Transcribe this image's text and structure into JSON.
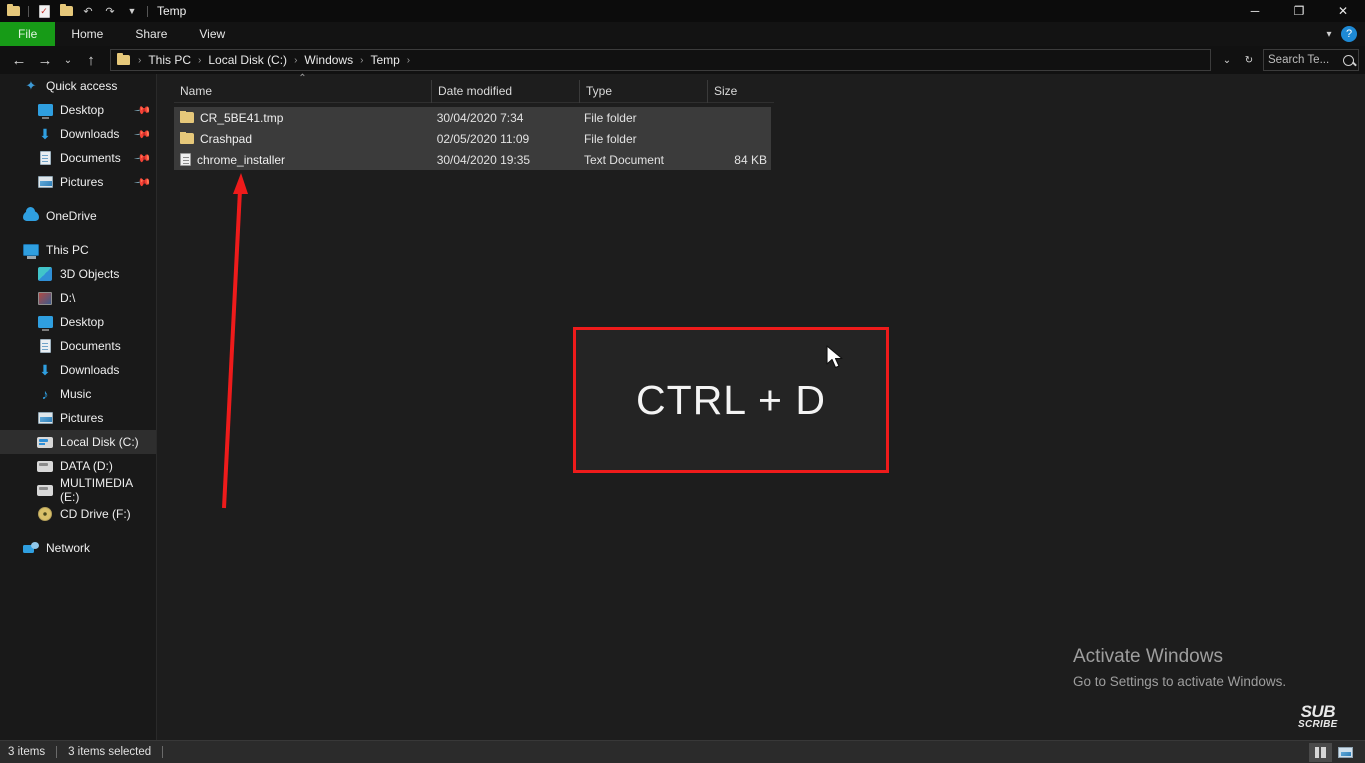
{
  "window": {
    "title": "Temp",
    "quick_access_icons": [
      "folder-icon",
      "properties-icon",
      "new-folder-icon",
      "undo-icon",
      "redo-icon",
      "customize-chevron-icon"
    ],
    "controls": {
      "minimize": "─",
      "maximize": "❐",
      "close": "✕"
    }
  },
  "ribbon": {
    "tabs": [
      {
        "label": "File",
        "accent": "#179b17"
      },
      {
        "label": "Home"
      },
      {
        "label": "Share"
      },
      {
        "label": "View"
      }
    ],
    "collapse_icon": "chevron-down-icon",
    "help_icon": "help-icon",
    "help_glyph": "?"
  },
  "address_bar": {
    "back_glyph": "←",
    "forward_glyph": "→",
    "recent_glyph": "⌄",
    "up_glyph": "↑",
    "crumbs": [
      "This PC",
      "Local Disk (C:)",
      "Windows",
      "Temp"
    ],
    "separator": "›",
    "history_glyph": "⌄",
    "refresh_glyph": "↻"
  },
  "search": {
    "placeholder": "Search Te...",
    "value": ""
  },
  "sidebar": {
    "items": [
      {
        "label": "Quick access",
        "icon": "star-icon",
        "level": 0,
        "pinned": false,
        "selected": false
      },
      {
        "label": "Desktop",
        "icon": "monitor-icon",
        "level": 1,
        "pinned": true,
        "selected": false
      },
      {
        "label": "Downloads",
        "icon": "download-icon",
        "level": 1,
        "pinned": true,
        "selected": false
      },
      {
        "label": "Documents",
        "icon": "document-icon",
        "level": 1,
        "pinned": true,
        "selected": false
      },
      {
        "label": "Pictures",
        "icon": "picture-icon",
        "level": 1,
        "pinned": true,
        "selected": false
      },
      {
        "label": "OneDrive",
        "icon": "cloud-icon",
        "level": 0,
        "pinned": false,
        "selected": false,
        "gap_before": true
      },
      {
        "label": "This PC",
        "icon": "pc-icon",
        "level": 0,
        "pinned": false,
        "selected": false,
        "gap_before": true
      },
      {
        "label": "3D Objects",
        "icon": "cube-icon",
        "level": 1,
        "pinned": false,
        "selected": false
      },
      {
        "label": "D:\\",
        "icon": "drive-icon",
        "level": 1,
        "pinned": false,
        "selected": false
      },
      {
        "label": "Desktop",
        "icon": "monitor-icon",
        "level": 1,
        "pinned": false,
        "selected": false
      },
      {
        "label": "Documents",
        "icon": "document-icon",
        "level": 1,
        "pinned": false,
        "selected": false
      },
      {
        "label": "Downloads",
        "icon": "download-icon",
        "level": 1,
        "pinned": false,
        "selected": false
      },
      {
        "label": "Music",
        "icon": "music-icon",
        "level": 1,
        "pinned": false,
        "selected": false
      },
      {
        "label": "Pictures",
        "icon": "picture-icon",
        "level": 1,
        "pinned": false,
        "selected": false
      },
      {
        "label": "Local Disk (C:)",
        "icon": "hdd-windows-icon",
        "level": 1,
        "pinned": false,
        "selected": true
      },
      {
        "label": "DATA (D:)",
        "icon": "hdd-icon",
        "level": 1,
        "pinned": false,
        "selected": false
      },
      {
        "label": "MULTIMEDIA (E:)",
        "icon": "hdd-icon",
        "level": 1,
        "pinned": false,
        "selected": false
      },
      {
        "label": "CD Drive (F:)",
        "icon": "cd-icon",
        "level": 1,
        "pinned": false,
        "selected": false
      },
      {
        "label": "Network",
        "icon": "network-icon",
        "level": 0,
        "pinned": false,
        "selected": false,
        "gap_before": true
      }
    ],
    "pin_glyph": "📌"
  },
  "file_list": {
    "columns": [
      {
        "label": "Name",
        "sorted": "ascending",
        "sort_glyph": "⌃"
      },
      {
        "label": "Date modified"
      },
      {
        "label": "Type"
      },
      {
        "label": "Size"
      }
    ],
    "rows": [
      {
        "name": "CR_5BE41.tmp",
        "date": "30/04/2020 7:34",
        "type": "File folder",
        "size": "",
        "icon": "folder-icon",
        "selected": true
      },
      {
        "name": "Crashpad",
        "date": "02/05/2020 11:09",
        "type": "File folder",
        "size": "",
        "icon": "folder-icon",
        "selected": true
      },
      {
        "name": "chrome_installer",
        "date": "30/04/2020 19:35",
        "type": "Text Document",
        "size": "84 KB",
        "icon": "text-document-icon",
        "selected": true
      }
    ]
  },
  "annotation": {
    "shortcut_text": "CTRL + D",
    "box_border_color": "#ee1b1b",
    "arrow_color": "#ee1b1b"
  },
  "watermark": {
    "line1": "Activate Windows",
    "line2": "Go to Settings to activate Windows.",
    "logo_line1": "SUB",
    "logo_line2": "SCRIBE"
  },
  "status_bar": {
    "item_count": "3 items",
    "selection": "3 items selected",
    "views": [
      {
        "name": "details-view",
        "active": true
      },
      {
        "name": "large-icons-view",
        "active": false
      }
    ]
  }
}
